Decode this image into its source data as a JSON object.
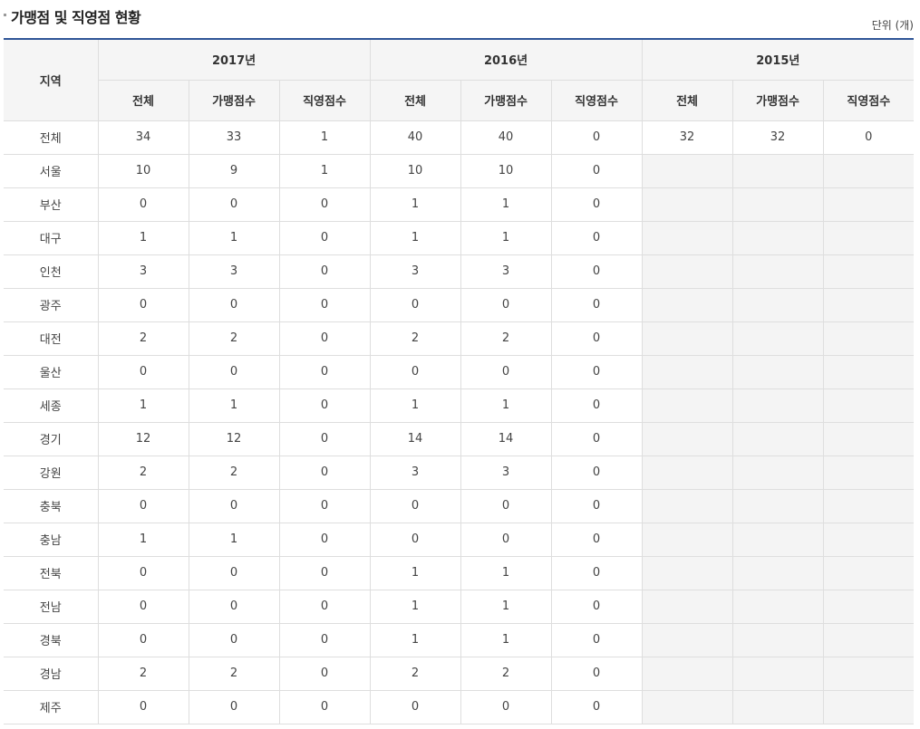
{
  "header": {
    "title": "가맹점 및 직영점 현황",
    "unit": "단위 (개)"
  },
  "table": {
    "region_header": "지역",
    "years": [
      "2017년",
      "2016년",
      "2015년"
    ],
    "sub_headers": [
      "전체",
      "가맹점수",
      "직영점수"
    ],
    "rows": [
      {
        "region": "전체",
        "y2017": [
          "34",
          "33",
          "1"
        ],
        "y2016": [
          "40",
          "40",
          "0"
        ],
        "y2015": [
          "32",
          "32",
          "0"
        ]
      },
      {
        "region": "서울",
        "y2017": [
          "10",
          "9",
          "1"
        ],
        "y2016": [
          "10",
          "10",
          "0"
        ],
        "y2015": [
          "",
          "",
          ""
        ]
      },
      {
        "region": "부산",
        "y2017": [
          "0",
          "0",
          "0"
        ],
        "y2016": [
          "1",
          "1",
          "0"
        ],
        "y2015": [
          "",
          "",
          ""
        ]
      },
      {
        "region": "대구",
        "y2017": [
          "1",
          "1",
          "0"
        ],
        "y2016": [
          "1",
          "1",
          "0"
        ],
        "y2015": [
          "",
          "",
          ""
        ]
      },
      {
        "region": "인천",
        "y2017": [
          "3",
          "3",
          "0"
        ],
        "y2016": [
          "3",
          "3",
          "0"
        ],
        "y2015": [
          "",
          "",
          ""
        ]
      },
      {
        "region": "광주",
        "y2017": [
          "0",
          "0",
          "0"
        ],
        "y2016": [
          "0",
          "0",
          "0"
        ],
        "y2015": [
          "",
          "",
          ""
        ]
      },
      {
        "region": "대전",
        "y2017": [
          "2",
          "2",
          "0"
        ],
        "y2016": [
          "2",
          "2",
          "0"
        ],
        "y2015": [
          "",
          "",
          ""
        ]
      },
      {
        "region": "울산",
        "y2017": [
          "0",
          "0",
          "0"
        ],
        "y2016": [
          "0",
          "0",
          "0"
        ],
        "y2015": [
          "",
          "",
          ""
        ]
      },
      {
        "region": "세종",
        "y2017": [
          "1",
          "1",
          "0"
        ],
        "y2016": [
          "1",
          "1",
          "0"
        ],
        "y2015": [
          "",
          "",
          ""
        ]
      },
      {
        "region": "경기",
        "y2017": [
          "12",
          "12",
          "0"
        ],
        "y2016": [
          "14",
          "14",
          "0"
        ],
        "y2015": [
          "",
          "",
          ""
        ]
      },
      {
        "region": "강원",
        "y2017": [
          "2",
          "2",
          "0"
        ],
        "y2016": [
          "3",
          "3",
          "0"
        ],
        "y2015": [
          "",
          "",
          ""
        ]
      },
      {
        "region": "충북",
        "y2017": [
          "0",
          "0",
          "0"
        ],
        "y2016": [
          "0",
          "0",
          "0"
        ],
        "y2015": [
          "",
          "",
          ""
        ]
      },
      {
        "region": "충남",
        "y2017": [
          "1",
          "1",
          "0"
        ],
        "y2016": [
          "0",
          "0",
          "0"
        ],
        "y2015": [
          "",
          "",
          ""
        ]
      },
      {
        "region": "전북",
        "y2017": [
          "0",
          "0",
          "0"
        ],
        "y2016": [
          "1",
          "1",
          "0"
        ],
        "y2015": [
          "",
          "",
          ""
        ]
      },
      {
        "region": "전남",
        "y2017": [
          "0",
          "0",
          "0"
        ],
        "y2016": [
          "1",
          "1",
          "0"
        ],
        "y2015": [
          "",
          "",
          ""
        ]
      },
      {
        "region": "경북",
        "y2017": [
          "0",
          "0",
          "0"
        ],
        "y2016": [
          "1",
          "1",
          "0"
        ],
        "y2015": [
          "",
          "",
          ""
        ]
      },
      {
        "region": "경남",
        "y2017": [
          "2",
          "2",
          "0"
        ],
        "y2016": [
          "2",
          "2",
          "0"
        ],
        "y2015": [
          "",
          "",
          ""
        ]
      },
      {
        "region": "제주",
        "y2017": [
          "0",
          "0",
          "0"
        ],
        "y2016": [
          "0",
          "0",
          "0"
        ],
        "y2015": [
          "",
          "",
          ""
        ]
      }
    ]
  },
  "colors": {
    "header_rule": "#2f5597",
    "header_bg": "#f5f5f5",
    "empty_cell_bg": "#f4f4f4",
    "grid_line": "#dedede"
  }
}
